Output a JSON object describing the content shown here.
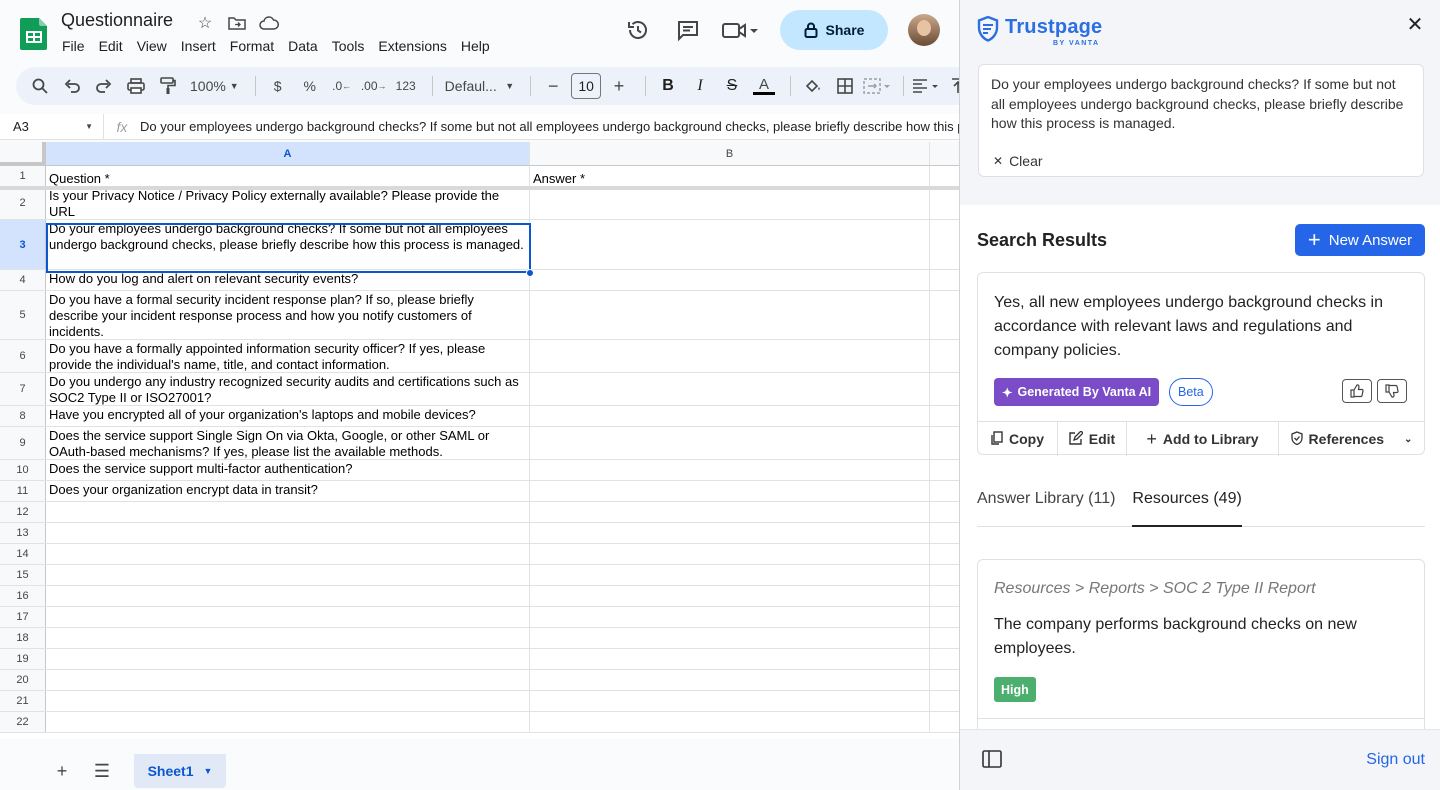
{
  "doc": {
    "title": "Questionnaire",
    "menu": [
      "File",
      "Edit",
      "View",
      "Insert",
      "Format",
      "Data",
      "Tools",
      "Extensions",
      "Help"
    ],
    "share_label": "Share"
  },
  "toolbar": {
    "zoom": "100%",
    "currency": "$",
    "percent": "%",
    "dec_decrease": ".0",
    "dec_increase": ".00",
    "number_format": "123",
    "font": "Defaul...",
    "font_size": "10",
    "bold": "B",
    "italic": "I",
    "strike": "S",
    "text_color": "A"
  },
  "formula_bar": {
    "name_box": "A3",
    "fx": "fx",
    "content": "Do your employees undergo background checks? If some but not all employees undergo background checks, please briefly describe how this process is managed."
  },
  "grid": {
    "columns": [
      "A",
      "B"
    ],
    "rows": [
      {
        "num": "1",
        "a": "Question *",
        "b": "Answer *"
      },
      {
        "num": "2",
        "a": "Is your Privacy Notice / Privacy Policy externally available? Please provide the URL",
        "b": ""
      },
      {
        "num": "3",
        "a": "Do your employees undergo background checks? If some but not all employees undergo background checks, please briefly describe how this process is managed.",
        "b": ""
      },
      {
        "num": "4",
        "a": "How do you log and alert on relevant security events?",
        "b": ""
      },
      {
        "num": "5",
        "a": "Do you have a formal security incident response plan? If so, please briefly describe your incident response process and how you notify customers of incidents.",
        "b": ""
      },
      {
        "num": "6",
        "a": "Do you have a formally appointed information security officer? If yes, please provide the individual's name, title, and contact information.",
        "b": ""
      },
      {
        "num": "7",
        "a": "Do you undergo any industry recognized security audits and certifications such as SOC2 Type II or ISO27001?",
        "b": ""
      },
      {
        "num": "8",
        "a": "Have you encrypted all of your organization's laptops and mobile devices?",
        "b": ""
      },
      {
        "num": "9",
        "a": "Does the service support Single Sign On via Okta, Google, or other SAML or OAuth-based mechanisms? If yes, please list the available methods.",
        "b": ""
      },
      {
        "num": "10",
        "a": "Does the service support multi-factor authentication?",
        "b": ""
      },
      {
        "num": "11",
        "a": "Does your organization encrypt data in transit?",
        "b": ""
      },
      {
        "num": "12",
        "a": "",
        "b": ""
      },
      {
        "num": "13",
        "a": "",
        "b": ""
      },
      {
        "num": "14",
        "a": "",
        "b": ""
      },
      {
        "num": "15",
        "a": "",
        "b": ""
      },
      {
        "num": "16",
        "a": "",
        "b": ""
      },
      {
        "num": "17",
        "a": "",
        "b": ""
      },
      {
        "num": "18",
        "a": "",
        "b": ""
      },
      {
        "num": "19",
        "a": "",
        "b": ""
      },
      {
        "num": "20",
        "a": "",
        "b": ""
      },
      {
        "num": "21",
        "a": "",
        "b": ""
      },
      {
        "num": "22",
        "a": "",
        "b": ""
      }
    ],
    "selected_cell": "A3"
  },
  "sheet_tabs": {
    "active": "Sheet1"
  },
  "panel": {
    "brand": "Trustpage",
    "brand_sub": "BY VANTA",
    "query": "Do your employees undergo background checks? If some but not all employees undergo background checks, please briefly describe how this process is managed.",
    "clear_label": "Clear",
    "search_results_title": "Search Results",
    "new_answer_label": "New Answer",
    "result": {
      "text": "Yes, all new employees undergo background checks in accordance with relevant laws and regulations and company policies.",
      "ai_badge": "Generated By Vanta AI",
      "beta_badge": "Beta",
      "actions": {
        "copy": "Copy",
        "edit": "Edit",
        "add_to_library": "Add to Library",
        "references": "References"
      }
    },
    "tabs": [
      {
        "label": "Answer Library (11)",
        "active": false
      },
      {
        "label": "Resources (49)",
        "active": true
      }
    ],
    "resource": {
      "path": "Resources > Reports > SOC 2 Type II Report",
      "text": "The company performs background checks on new employees.",
      "confidence": "High"
    },
    "sign_out_label": "Sign out"
  },
  "colors": {
    "sheets_green": "#0f9d58",
    "share_bg": "#c2e7ff",
    "selection_blue": "#0b57d0",
    "trustpage_blue": "#2566e8",
    "vanta_ai_purple": "#7b4cc7",
    "high_green": "#4caf6e"
  }
}
